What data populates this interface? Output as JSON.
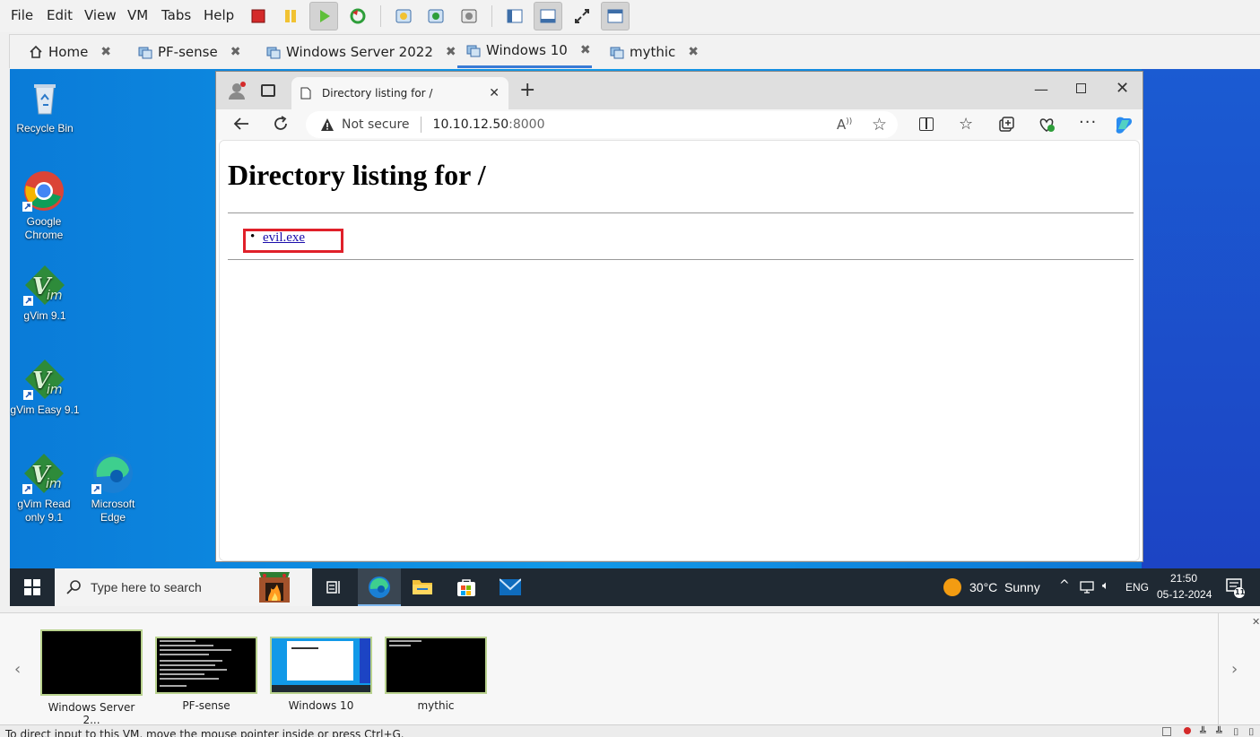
{
  "menubar": {
    "items": [
      "File",
      "Edit",
      "View",
      "VM",
      "Tabs",
      "Help"
    ]
  },
  "vm_tabs": [
    {
      "label": "Home"
    },
    {
      "label": "PF-sense"
    },
    {
      "label": "Windows Server 2022"
    },
    {
      "label": "Windows 10"
    },
    {
      "label": "mythic"
    }
  ],
  "desktop_icons": [
    {
      "label": "Recycle Bin"
    },
    {
      "label": "Google Chrome"
    },
    {
      "label": "gVim 9.1"
    },
    {
      "label": "gVim Easy 9.1"
    },
    {
      "label": "gVim Read only 9.1"
    },
    {
      "label": "Microsoft Edge"
    }
  ],
  "browser": {
    "tab_title": "Directory listing for /",
    "security_label": "Not secure",
    "url_host": "10.10.12.50",
    "url_port": ":8000",
    "heading": "Directory listing for /",
    "files": [
      "evil.exe"
    ],
    "highlight_color": "#e0202a"
  },
  "taskbar": {
    "search_placeholder": "Type here to search",
    "weather_temp": "30°C",
    "weather_text": "Sunny",
    "lang": "ENG",
    "time": "21:50",
    "date": "05-12-2024",
    "notif_count": "11"
  },
  "thumbnails": [
    {
      "label": "Windows Server 2..."
    },
    {
      "label": "PF-sense"
    },
    {
      "label": "Windows 10"
    },
    {
      "label": "mythic"
    }
  ],
  "status_text": "To direct input to this VM, move the mouse pointer inside or press Ctrl+G."
}
